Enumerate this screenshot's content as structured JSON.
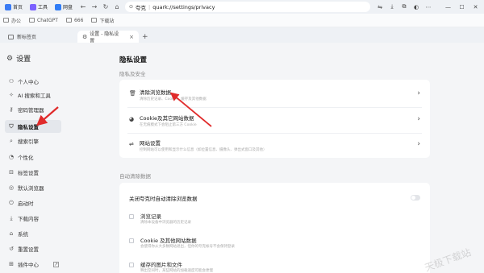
{
  "browser": {
    "quick_tabs": [
      {
        "label": "首页",
        "color": "#3a7bf4"
      },
      {
        "label": "工具",
        "color": "#7b61ff"
      },
      {
        "label": "网盘",
        "color": "#2f7cf6"
      }
    ],
    "url_host": "夸克",
    "url": "quark://settings/privacy",
    "bookmarks": [
      "办公",
      "ChatGPT",
      "666",
      "下载站"
    ],
    "tabs": [
      {
        "label": "新标签页"
      },
      {
        "label": "设置 - 隐私设置"
      }
    ]
  },
  "sidebar": {
    "title": "设置",
    "items": [
      {
        "label": "个人中心",
        "icon": "user-icon"
      },
      {
        "label": "AI 搜索和工具",
        "icon": "sparkle-icon"
      },
      {
        "label": "密码管理器",
        "icon": "key-icon"
      },
      {
        "label": "隐私设置",
        "icon": "shield-icon",
        "active": true
      },
      {
        "label": "搜索引擎",
        "icon": "search-icon"
      },
      {
        "label": "个性化",
        "icon": "palette-icon"
      },
      {
        "label": "标签设置",
        "icon": "tag-icon"
      },
      {
        "label": "默认浏览器",
        "icon": "browser-icon"
      },
      {
        "label": "启动时",
        "icon": "power-icon"
      },
      {
        "label": "下载内容",
        "icon": "download-icon"
      },
      {
        "label": "系统",
        "icon": "system-icon"
      },
      {
        "label": "重置设置",
        "icon": "reset-icon"
      },
      {
        "label": "插件中心",
        "icon": "plugin-icon"
      }
    ]
  },
  "main": {
    "title": "隐私设置",
    "section1_label": "隐私及安全",
    "rows": [
      {
        "title": "清除浏览数据",
        "desc": "清除历史记录、Cookie、缓存及其他数据"
      },
      {
        "title": "Cookie及其它网站数据",
        "desc": "在无痕模式下会阻止第三方 Cookie"
      },
      {
        "title": "网站设置",
        "desc": "控制网站可以使用和显示什么信息（如位置信息、摄像头、弹出式窗口及其他）"
      }
    ],
    "section2_label": "自动清除数据",
    "auto_clear_label": "关闭夸克时自动清除浏览数据",
    "checkboxes": [
      {
        "title": "浏览记录",
        "desc": "清除本设备中浏览器的历史记录"
      },
      {
        "title": "Cookie 及其他网站数据",
        "desc": "会使得你从大多数网站退出，但你的夸克帐号不会保持登录"
      },
      {
        "title": "缓存的图片和文件",
        "desc": "释出空间时，某些网站的加载速度可能会更慢"
      }
    ]
  },
  "watermark": "天极下载站",
  "colors": {
    "accent_arrow": "#e02b2b",
    "active_bg": "#e4e7ec"
  }
}
